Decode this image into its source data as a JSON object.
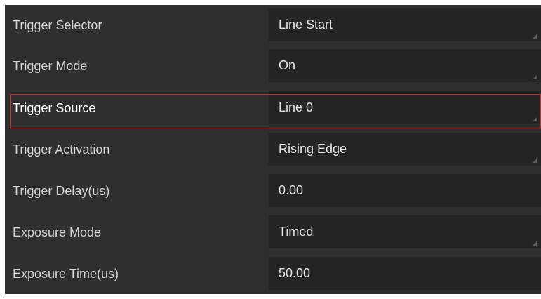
{
  "properties": [
    {
      "label": "Trigger Selector",
      "value": "Line Start"
    },
    {
      "label": "Trigger Mode",
      "value": "On"
    },
    {
      "label": "Trigger Source",
      "value": "Line 0"
    },
    {
      "label": "Trigger Activation",
      "value": "Rising Edge"
    },
    {
      "label": "Trigger Delay(us)",
      "value": "0.00"
    },
    {
      "label": "Exposure Mode",
      "value": "Timed"
    },
    {
      "label": "Exposure Time(us)",
      "value": "50.00"
    }
  ],
  "selected_property": "Trigger Source",
  "colors": {
    "panel_background": "#2f2f2f",
    "value_background": "#252525",
    "label_text": "#d2d2d2",
    "highlight_border": "#d2232a"
  }
}
